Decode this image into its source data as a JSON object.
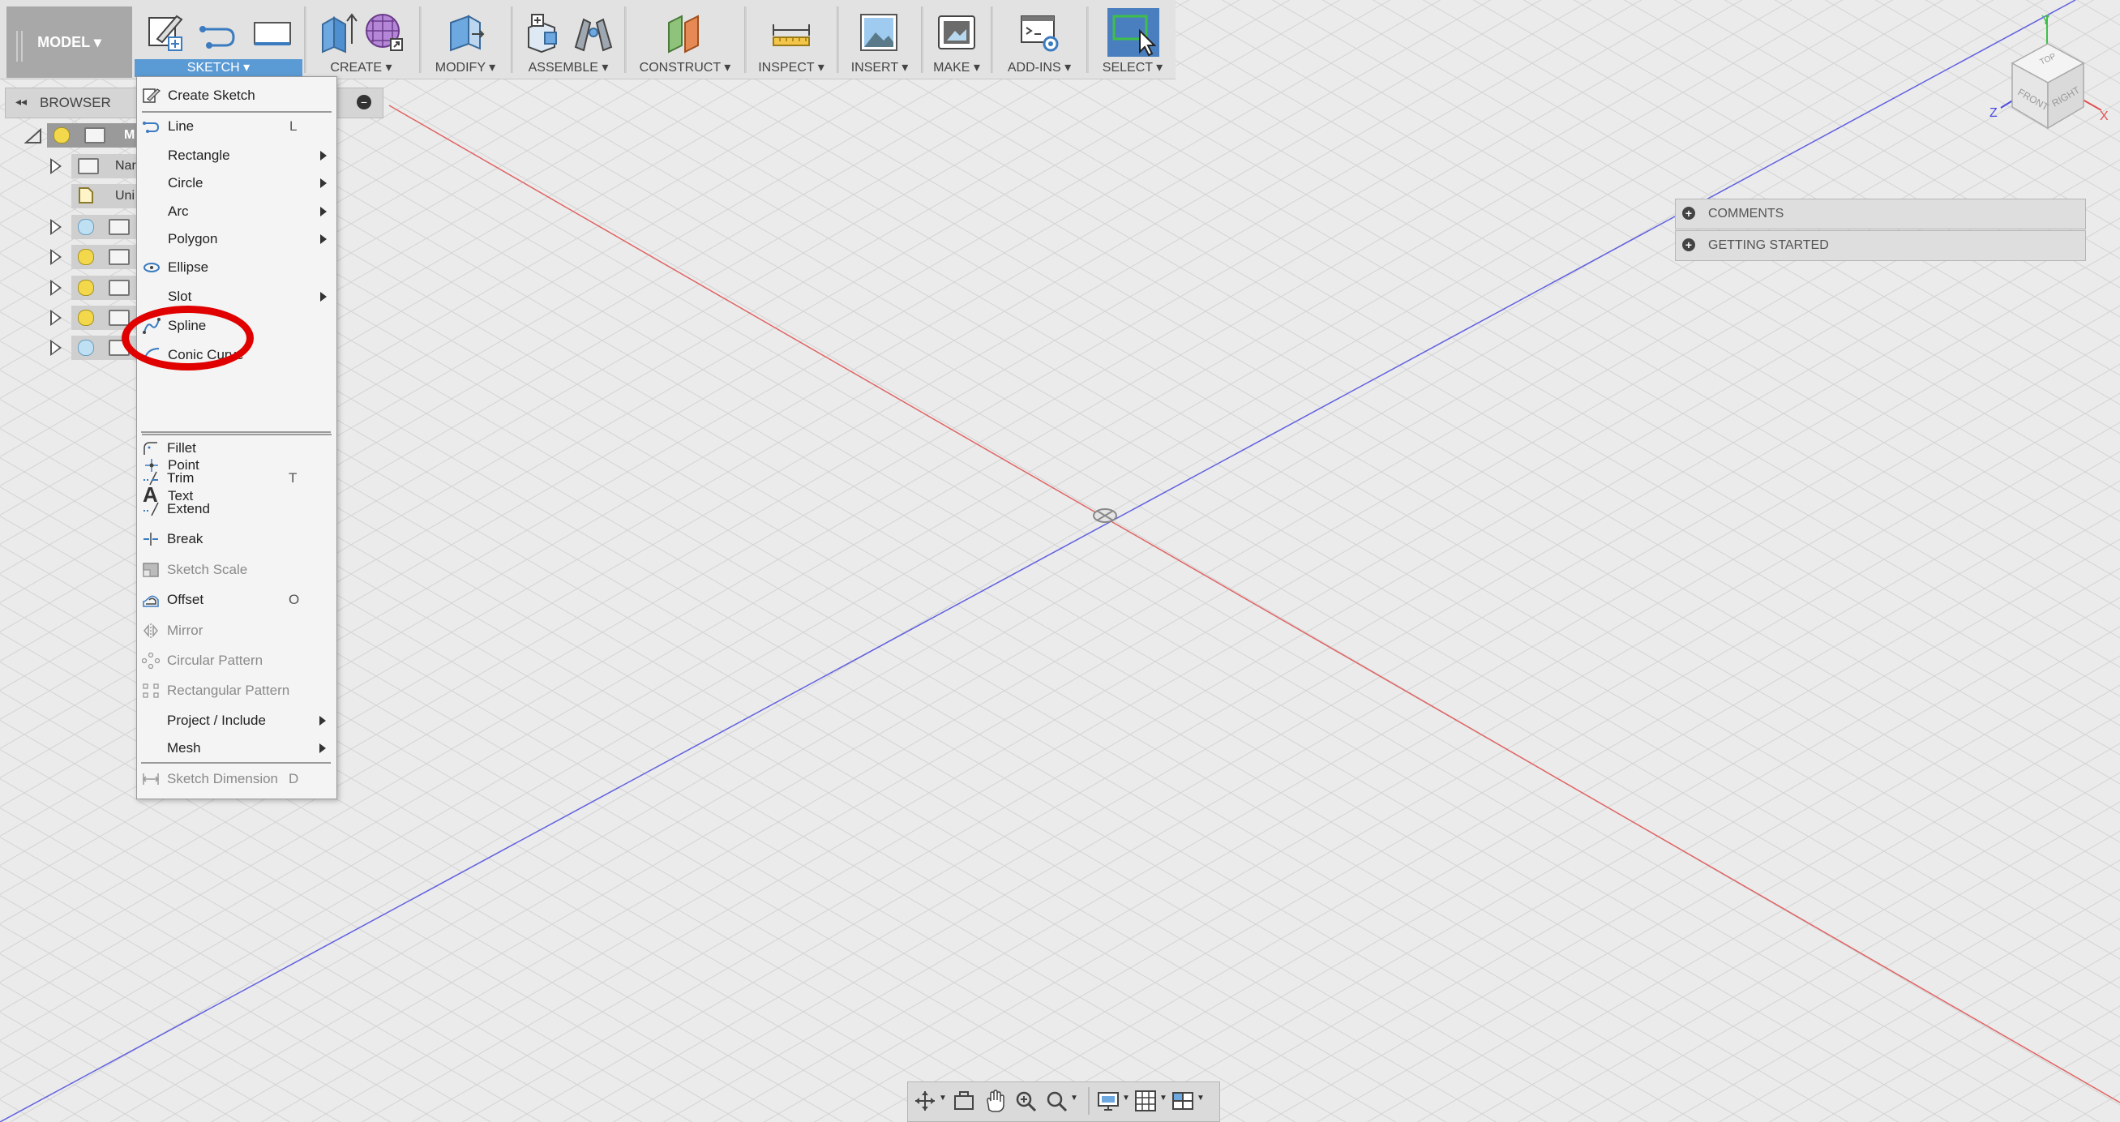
{
  "toolbar": {
    "model_label": "MODEL",
    "groups": [
      {
        "label": "SKETCH"
      },
      {
        "label": "CREATE"
      },
      {
        "label": "MODIFY"
      },
      {
        "label": "ASSEMBLE"
      },
      {
        "label": "CONSTRUCT"
      },
      {
        "label": "INSPECT"
      },
      {
        "label": "INSERT"
      },
      {
        "label": "MAKE"
      },
      {
        "label": "ADD-INS"
      },
      {
        "label": "SELECT"
      }
    ]
  },
  "browser": {
    "title": "BROWSER",
    "items": [
      {
        "label": "M"
      },
      {
        "label": "Nar"
      },
      {
        "label": "Uni"
      }
    ]
  },
  "sketch_menu": {
    "items": [
      {
        "label": "Create Sketch",
        "icon": "create-sketch-icon"
      },
      {
        "label": "Line",
        "shortcut": "L",
        "icon": "line-icon"
      },
      {
        "label": "Rectangle",
        "submenu": true
      },
      {
        "label": "Circle",
        "submenu": true
      },
      {
        "label": "Arc",
        "submenu": true
      },
      {
        "label": "Polygon",
        "submenu": true
      },
      {
        "label": "Ellipse",
        "icon": "ellipse-icon"
      },
      {
        "label": "Slot",
        "submenu": true
      },
      {
        "label": "Spline",
        "icon": "spline-icon"
      },
      {
        "label": "Conic Curve",
        "icon": "conic-curve-icon"
      },
      {
        "label": "Point",
        "icon": "point-icon"
      },
      {
        "label": "Text",
        "icon": "text-icon"
      },
      {
        "label": "Fillet",
        "icon": "fillet-icon"
      },
      {
        "label": "Trim",
        "shortcut": "T",
        "icon": "trim-icon"
      },
      {
        "label": "Extend",
        "icon": "extend-icon"
      },
      {
        "label": "Break",
        "icon": "break-icon"
      },
      {
        "label": "Sketch Scale",
        "disabled": true,
        "icon": "sketch-scale-icon"
      },
      {
        "label": "Offset",
        "shortcut": "O",
        "icon": "offset-icon"
      },
      {
        "label": "Mirror",
        "disabled": true,
        "icon": "mirror-icon"
      },
      {
        "label": "Circular Pattern",
        "disabled": true,
        "icon": "circular-pattern-icon"
      },
      {
        "label": "Rectangular Pattern",
        "disabled": true,
        "icon": "rectangular-pattern-icon"
      },
      {
        "label": "Project / Include",
        "submenu": true
      },
      {
        "label": "Mesh",
        "submenu": true
      },
      {
        "label": "Sketch Dimension",
        "shortcut": "D",
        "disabled": true,
        "icon": "sketch-dimension-icon"
      }
    ]
  },
  "right_panels": [
    {
      "label": "COMMENTS"
    },
    {
      "label": "GETTING STARTED"
    }
  ],
  "viewcube": {
    "top": "TOP",
    "front": "FRONT",
    "right": "RIGHT",
    "axis_x": "X",
    "axis_y": "Y",
    "axis_z": "Z"
  },
  "colors": {
    "accent": "#5b9bd5",
    "x_axis": "#e05050",
    "z_axis": "#4a4ae0",
    "highlight": "#e00000"
  }
}
